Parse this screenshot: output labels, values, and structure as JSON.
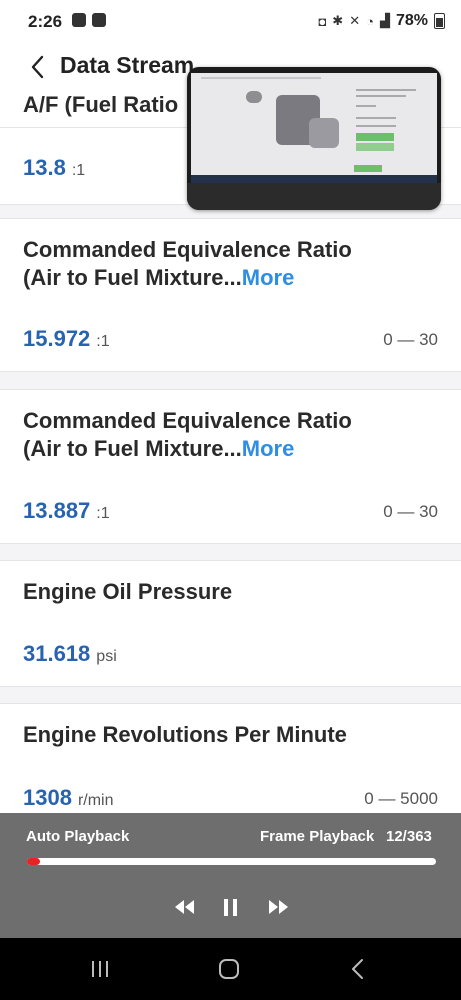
{
  "status": {
    "time": "2:26",
    "battery": "78%"
  },
  "header": {
    "title": "Data Stream"
  },
  "items": [
    {
      "title": "A/F (Fuel Ratio",
      "more": "",
      "value": "13.8",
      "unit": ":1",
      "range": ""
    },
    {
      "title": "Commanded Equivalence Ratio",
      "title2": "(Air to Fuel Mixture...",
      "more": "More",
      "value": "15.972",
      "unit": ":1",
      "range": "0 — 30"
    },
    {
      "title": "Commanded Equivalence Ratio",
      "title2": "(Air to Fuel Mixture...",
      "more": "More",
      "value": "13.887",
      "unit": ":1",
      "range": "0 — 30"
    },
    {
      "title": "Engine Oil Pressure",
      "more": "",
      "value": "31.618",
      "unit": "psi",
      "range": ""
    },
    {
      "title": "Engine Revolutions Per Minute",
      "more": "",
      "value": "1308",
      "unit": "r/min",
      "range": "0 — 5000"
    }
  ],
  "player": {
    "auto_label": "Auto Playback",
    "frame_label": "Frame Playback",
    "counter": "12/363",
    "progress_fraction": 0.033
  },
  "colors": {
    "value_blue": "#2763b0",
    "more_link": "#2f8de4",
    "progress_red": "#e52521"
  }
}
